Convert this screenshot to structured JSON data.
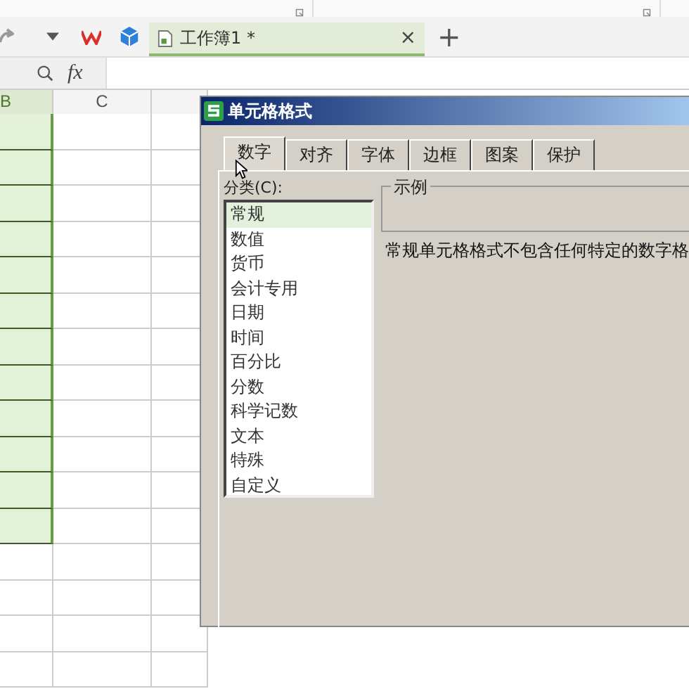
{
  "tab_bar": {
    "tabs": [
      {
        "label": "工作簿1 *",
        "selected": true
      }
    ],
    "close": "×",
    "add": "+"
  },
  "formula_bar": {
    "fx": "fx"
  },
  "sheet": {
    "columns": [
      {
        "label": "B",
        "selected": true
      },
      {
        "label": "C",
        "selected": false
      }
    ],
    "rows": [
      {
        "selected": true
      },
      {
        "selected": true
      },
      {
        "selected": true
      },
      {
        "selected": true
      },
      {
        "selected": true
      },
      {
        "selected": true
      },
      {
        "selected": true
      },
      {
        "selected": true
      },
      {
        "selected": true
      },
      {
        "selected": true
      },
      {
        "selected": true
      },
      {
        "selected": true
      },
      {
        "selected": false
      },
      {
        "selected": false
      },
      {
        "selected": false
      },
      {
        "selected": false
      }
    ]
  },
  "dialog": {
    "title": "单元格格式",
    "tabs": [
      {
        "label": "数字",
        "selected": true
      },
      {
        "label": "对齐",
        "selected": false
      },
      {
        "label": "字体",
        "selected": false
      },
      {
        "label": "边框",
        "selected": false
      },
      {
        "label": "图案",
        "selected": false
      },
      {
        "label": "保护",
        "selected": false
      }
    ],
    "category_label": "分类(C):",
    "categories": [
      {
        "label": "常规",
        "selected": true
      },
      {
        "label": "数值",
        "selected": false
      },
      {
        "label": "货币",
        "selected": false
      },
      {
        "label": "会计专用",
        "selected": false
      },
      {
        "label": "日期",
        "selected": false
      },
      {
        "label": "时间",
        "selected": false
      },
      {
        "label": "百分比",
        "selected": false
      },
      {
        "label": "分数",
        "selected": false
      },
      {
        "label": "科学记数",
        "selected": false
      },
      {
        "label": "文本",
        "selected": false
      },
      {
        "label": "特殊",
        "selected": false
      },
      {
        "label": "自定义",
        "selected": false
      }
    ],
    "sample_label": "示例",
    "description": "常规单元格格式不包含任何特定的数字格"
  }
}
